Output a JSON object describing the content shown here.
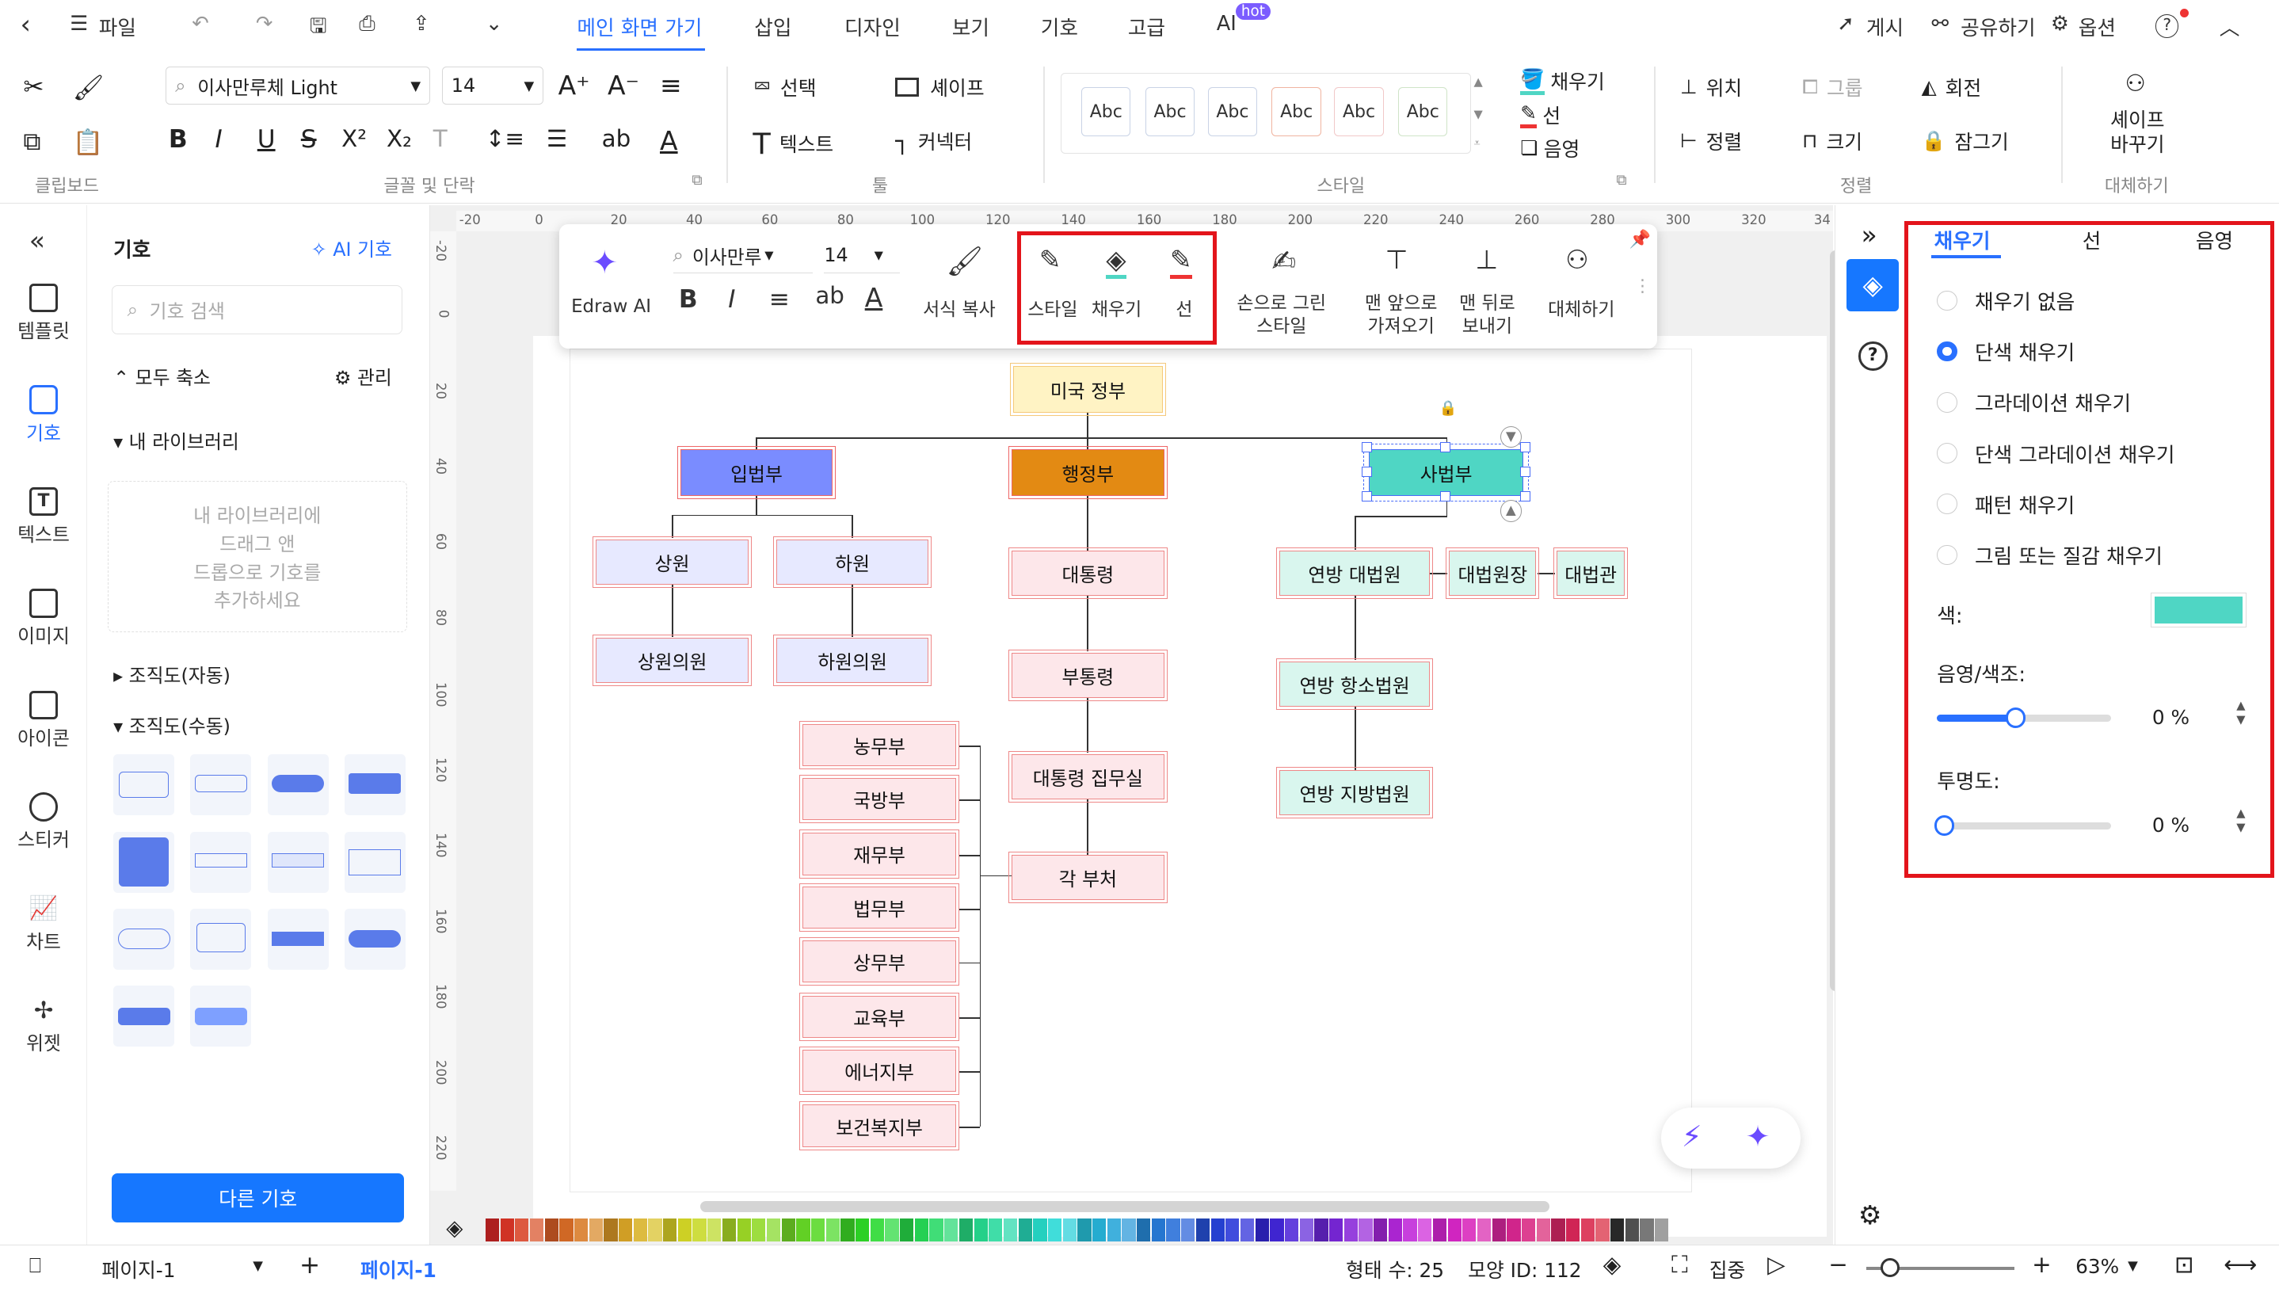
{
  "titlebar": {
    "file": "파일",
    "tabs": [
      "메인 화면 가기",
      "삽입",
      "디자인",
      "보기",
      "기호",
      "고급",
      "AI"
    ],
    "hot": "hot",
    "publish": "게시",
    "share": "공유하기",
    "options": "옵션",
    "help": "?"
  },
  "ribbon": {
    "font_family": "이사만루체 Light",
    "font_size": "14",
    "select": "선택",
    "shape": "셰이프",
    "text": "텍스트",
    "connector": "커넥터",
    "style_abc": [
      "Abc",
      "Abc",
      "Abc",
      "Abc",
      "Abc",
      "Abc"
    ],
    "fill": "채우기",
    "line": "선",
    "shadow": "음영",
    "position": "위치",
    "group": "그룹",
    "rotate": "회전",
    "align": "정렬",
    "size": "크기",
    "lock": "잠그기",
    "replace_shape": [
      "셰이프",
      "바꾸기"
    ],
    "groups": [
      "클립보드",
      "글꼴 및 단락",
      "툴",
      "스타일",
      "정렬",
      "대체하기"
    ]
  },
  "left_nav": [
    "템플릿",
    "기호",
    "텍스트",
    "이미지",
    "아이콘",
    "스티커",
    "차트",
    "위젯"
  ],
  "library": {
    "title": "기호",
    "ai": "AI 기호",
    "search_placeholder": "기호 검색",
    "collapse": "모두 축소",
    "manage": "관리",
    "my_library": "내 라이브러리",
    "drop_hint": [
      "내 라이브러리에",
      "드래그 앤",
      "드롭으로 기호를",
      "추가하세요"
    ],
    "org_auto": "조직도(자동)",
    "org_manual": "조직도(수동)",
    "more": "다른 기호"
  },
  "ruler_top": [
    "-20",
    "0",
    "20",
    "40",
    "60",
    "80",
    "100",
    "120",
    "140",
    "160",
    "180",
    "200",
    "220",
    "240",
    "260",
    "280",
    "300",
    "320",
    "34"
  ],
  "ruler_left": [
    "-20",
    "0",
    "20",
    "40",
    "60",
    "80",
    "100",
    "120",
    "140",
    "160",
    "180",
    "200",
    "220"
  ],
  "context_toolbar": {
    "edraw_ai": "Edraw AI",
    "font": "이사만루",
    "size": "14",
    "format_copy": "서식 복사",
    "style": "스타일",
    "fill": "채우기",
    "line": "선",
    "hand": [
      "손으로 그린",
      "스타일"
    ],
    "front": [
      "맨 앞으로",
      "가져오기"
    ],
    "back": [
      "맨 뒤로",
      "보내기"
    ],
    "replace": "대체하기"
  },
  "chart": {
    "root": "미국 정부",
    "legislative": "입법부",
    "executive": "행정부",
    "judicial": "사법부",
    "senate": "상원",
    "house": "하원",
    "senators": "상원의원",
    "representatives": "하원의원",
    "president": "대통령",
    "vp": "부통령",
    "eop": "대통령 집무실",
    "depts": "각 부처",
    "depts_list": [
      "농무부",
      "국방부",
      "재무부",
      "법무부",
      "상무부",
      "교육부",
      "에너지부",
      "보건복지부"
    ],
    "supreme": "연방 대법원",
    "chief": "대법원장",
    "justice": "대법관",
    "appeals": "연방 항소법원",
    "district": "연방 지방법원"
  },
  "right_panel": {
    "tabs": [
      "채우기",
      "선",
      "음영"
    ],
    "options": [
      "채우기 없음",
      "단색 채우기",
      "그라데이션 채우기",
      "단색 그라데이션 채우기",
      "패턴 채우기",
      "그림 또는 질감 채우기"
    ],
    "color_label": "색:",
    "color": "#4fd6c4",
    "shade_label": "음영/색조:",
    "shade_value": "0 %",
    "shade_level": 0.45,
    "transparency_label": "투명도:",
    "transparency_value": "0 %"
  },
  "status": {
    "page_tab": "페이지-1",
    "page_active": "페이지-1",
    "shapes": "형태 수: 25",
    "shape_id": "모양 ID: 112",
    "focus": "집중",
    "zoom": "63%"
  },
  "colors": {
    "accent": "#2970ff",
    "highlight": "#e3141b"
  }
}
